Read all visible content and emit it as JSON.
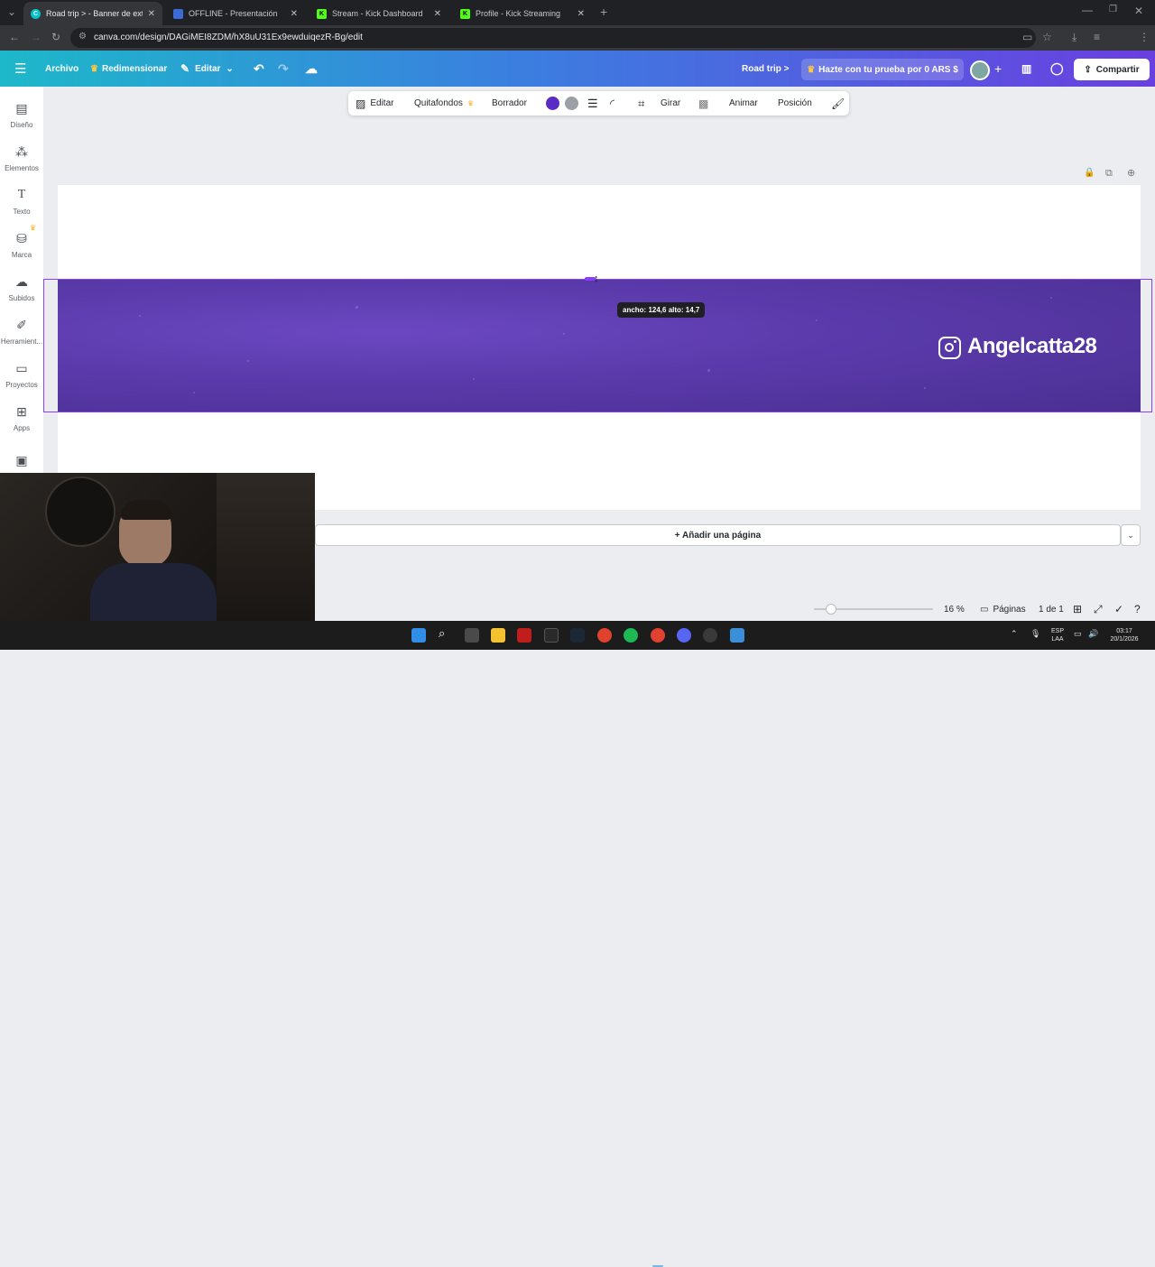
{
  "browser": {
    "tabs": [
      {
        "title": "Road trip > - Banner de exterior",
        "favicon": "canva-icon",
        "active": true
      },
      {
        "title": "OFFLINE - Presentación",
        "favicon": "canva-shield-icon",
        "active": false
      },
      {
        "title": "Stream - Kick Dashboard",
        "favicon": "kick-icon",
        "active": false
      },
      {
        "title": "Profile - Kick Streaming",
        "favicon": "kick-icon",
        "active": false
      }
    ],
    "url": "canva.com/design/DAGiMEI8ZDM/hX8uU31Ex9ewduiqezR-Bg/edit"
  },
  "topbar": {
    "archivo": "Archivo",
    "redimensionar": "Redimensionar",
    "editar": "Editar",
    "project_title": "Road trip >",
    "trial": "Hazte con tu prueba por 0 ARS $",
    "share": "Compartir"
  },
  "sidebar": {
    "items": [
      {
        "label": "Diseño",
        "icon": "design-icon"
      },
      {
        "label": "Elementos",
        "icon": "elements-icon"
      },
      {
        "label": "Texto",
        "icon": "text-icon"
      },
      {
        "label": "Marca",
        "icon": "brand-icon"
      },
      {
        "label": "Subidos",
        "icon": "upload-icon"
      },
      {
        "label": "Herramient...",
        "icon": "tools-icon"
      },
      {
        "label": "Proyectos",
        "icon": "folder-icon"
      },
      {
        "label": "Apps",
        "icon": "apps-icon"
      }
    ]
  },
  "context_toolbar": {
    "editar": "Editar",
    "quitafondos": "Quitafondos",
    "borrador": "Borrador",
    "color_1": "#5b2bc6",
    "color_2": "#9aa0a6",
    "girar": "Girar",
    "animar": "Animar",
    "posicion": "Posición"
  },
  "canvas": {
    "tooltip": "ancho: 124,6 alto: 14,7",
    "banner_text": "Angelcatta28",
    "banner_color": "#5a3aaa",
    "add_page": "+ Añadir una página"
  },
  "status": {
    "zoom": "16 %",
    "pages_label": "Páginas",
    "page_count": "1 de 1"
  },
  "taskbar": {
    "lang_top": "ESP",
    "lang_bottom": "LAA",
    "time": "03:17",
    "date": "20/1/2026"
  }
}
